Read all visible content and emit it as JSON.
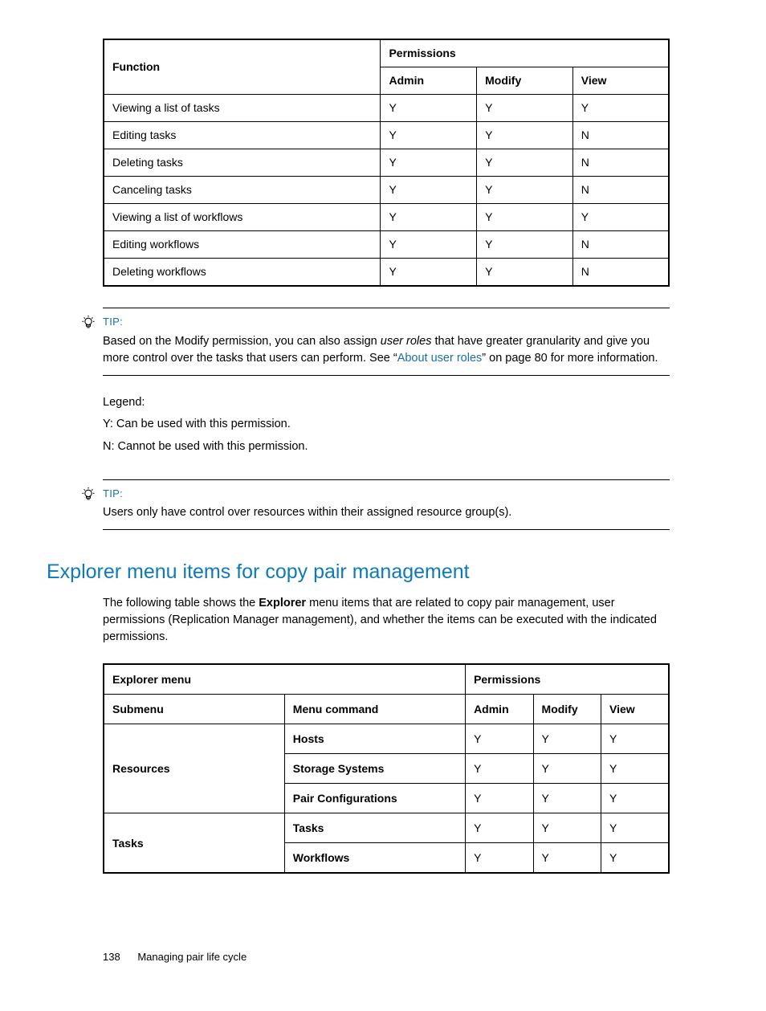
{
  "table1": {
    "header_function": "Function",
    "header_permissions": "Permissions",
    "header_admin": "Admin",
    "header_modify": "Modify",
    "header_view": "View",
    "rows": [
      {
        "func": "Viewing a list of tasks",
        "admin": "Y",
        "modify": "Y",
        "view": "Y"
      },
      {
        "func": "Editing tasks",
        "admin": "Y",
        "modify": "Y",
        "view": "N"
      },
      {
        "func": "Deleting tasks",
        "admin": "Y",
        "modify": "Y",
        "view": "N"
      },
      {
        "func": "Canceling tasks",
        "admin": "Y",
        "modify": "Y",
        "view": "N"
      },
      {
        "func": "Viewing a list of workflows",
        "admin": "Y",
        "modify": "Y",
        "view": "Y"
      },
      {
        "func": "Editing workflows",
        "admin": "Y",
        "modify": "Y",
        "view": "N"
      },
      {
        "func": "Deleting workflows",
        "admin": "Y",
        "modify": "Y",
        "view": "N"
      }
    ]
  },
  "tip1": {
    "label": "TIP:",
    "text_before": "Based on the Modify permission, you can also assign ",
    "italic": "user roles",
    "text_mid": " that have greater granularity and give you more control over the tasks that users can perform. See “",
    "link": "About user roles",
    "text_after": "” on page 80 for more information."
  },
  "legend": {
    "title": "Legend:",
    "y": "Y: Can be used with this permission.",
    "n": "N: Cannot be used with this permission."
  },
  "tip2": {
    "label": "TIP:",
    "text": "Users only have control over resources within their assigned resource group(s)."
  },
  "section": {
    "heading": "Explorer menu items for copy pair management",
    "intro_before": "The following table shows the ",
    "intro_bold": "Explorer",
    "intro_after": " menu items that are related to copy pair management, user permissions (Replication Manager management), and whether the items can be executed with the indicated permissions."
  },
  "table2": {
    "header_explorer": "Explorer menu",
    "header_permissions": "Permissions",
    "header_submenu": "Submenu",
    "header_command": "Menu command",
    "header_admin": "Admin",
    "header_modify": "Modify",
    "header_view": "View",
    "groups": [
      {
        "submenu": "Resources",
        "rows": [
          {
            "cmd": "Hosts",
            "admin": "Y",
            "modify": "Y",
            "view": "Y"
          },
          {
            "cmd": "Storage Systems",
            "admin": "Y",
            "modify": "Y",
            "view": "Y"
          },
          {
            "cmd": "Pair Configurations",
            "admin": "Y",
            "modify": "Y",
            "view": "Y"
          }
        ]
      },
      {
        "submenu": "Tasks",
        "rows": [
          {
            "cmd": "Tasks",
            "admin": "Y",
            "modify": "Y",
            "view": "Y"
          },
          {
            "cmd": "Workflows",
            "admin": "Y",
            "modify": "Y",
            "view": "Y"
          }
        ]
      }
    ]
  },
  "footer": {
    "page_number": "138",
    "chapter": "Managing pair life cycle"
  }
}
